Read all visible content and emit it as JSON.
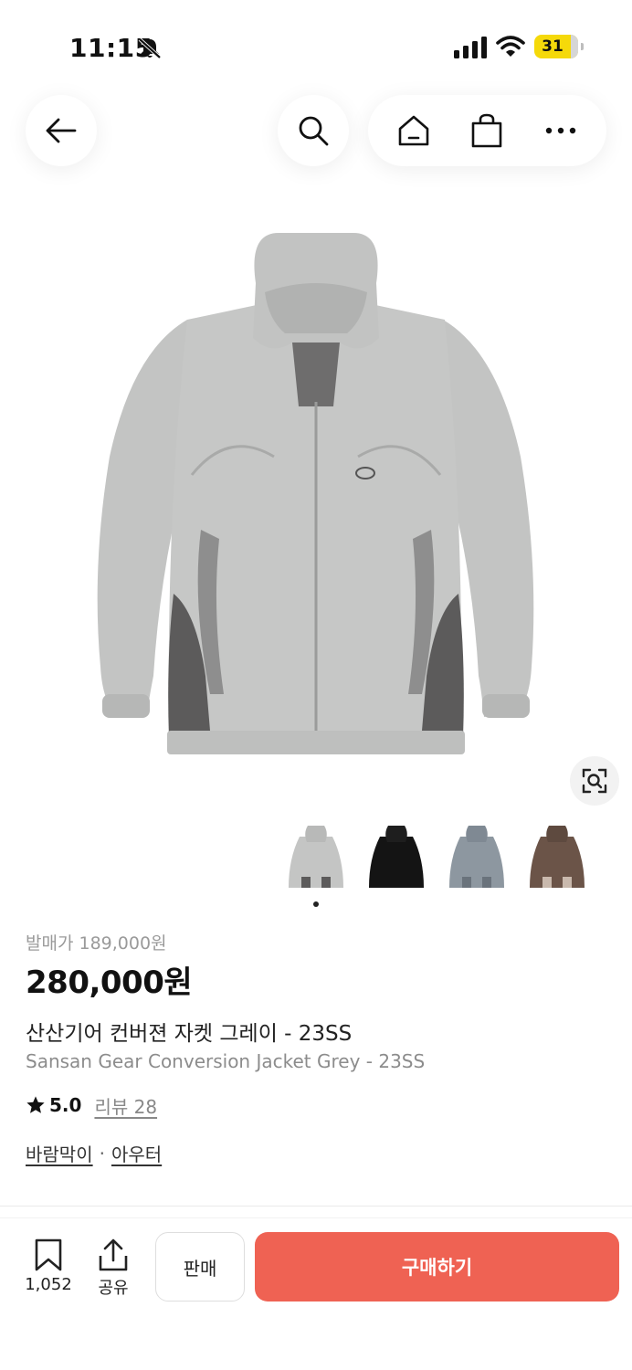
{
  "status_bar": {
    "time": "11:15",
    "battery": "31"
  },
  "nav": {
    "back_icon": "arrow-left-icon",
    "search_icon": "search-icon",
    "home_icon": "home-icon",
    "bag_icon": "shopping-bag-icon",
    "more_icon": "more-horizontal-icon"
  },
  "product": {
    "release_price": "발매가 189,000원",
    "price": "280,000원",
    "name_ko": "산산기어 컨버젼 자켓 그레이 - 23SS",
    "name_en": "Sansan Gear Conversion Jacket Grey - 23SS",
    "rating": "5.0",
    "reviews": "리뷰 28",
    "categories": [
      "바람막이",
      "아우터"
    ],
    "category_separator": "·"
  },
  "colors": [
    "#c4c5c4",
    "#141414",
    "#8d97a0",
    "#6b5448"
  ],
  "bottom_bar": {
    "bookmark_count": "1,052",
    "share_label": "공유",
    "sell_label": "판매",
    "buy_label": "구매하기"
  },
  "theme": {
    "accent": "#ef6253"
  }
}
